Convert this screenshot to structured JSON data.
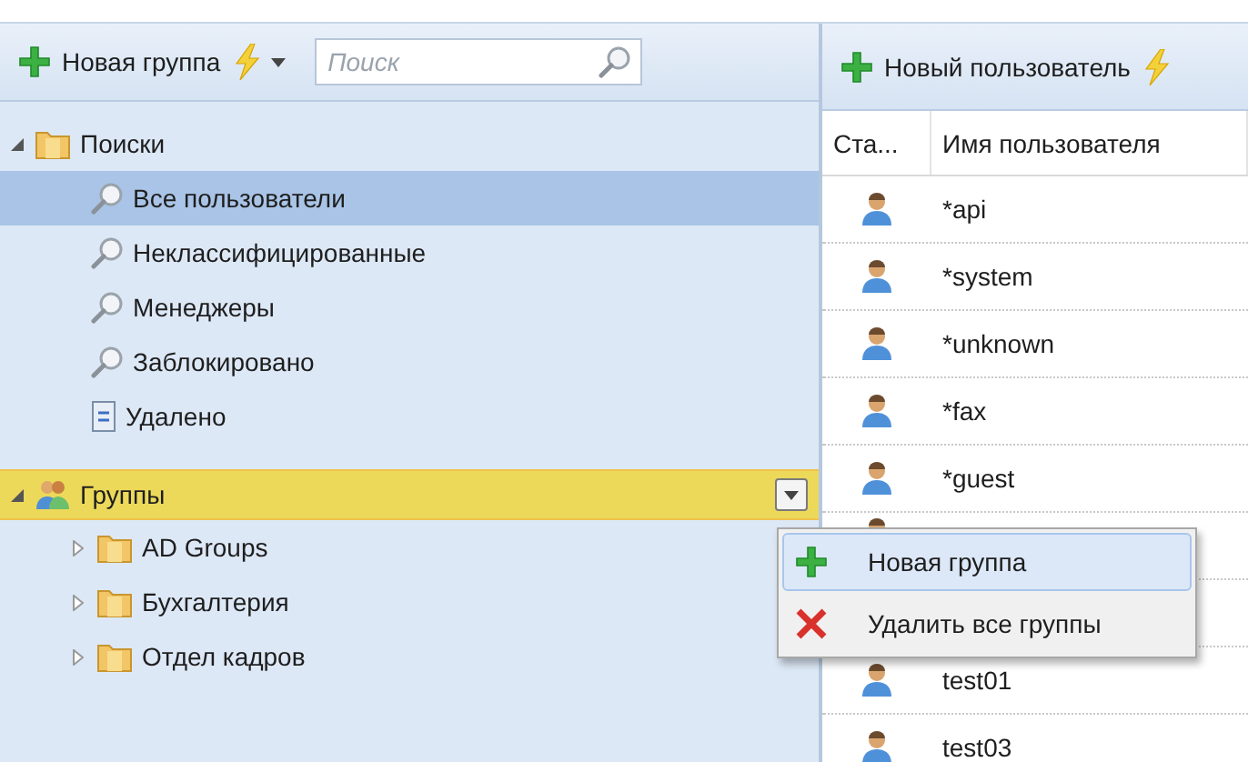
{
  "left_toolbar": {
    "new_group": "Новая группа",
    "search": {
      "placeholder": "Поиск"
    }
  },
  "tree": [
    {
      "label": "Поиски",
      "kind": "searches",
      "expanded": true,
      "highlighted": false,
      "children": [
        {
          "label": "Все пользователи",
          "kind": "search",
          "selected": true
        },
        {
          "label": "Неклассифицированные",
          "kind": "search",
          "selected": false
        },
        {
          "label": "Менеджеры",
          "kind": "search",
          "selected": false
        },
        {
          "label": "Заблокировано",
          "kind": "search",
          "selected": false
        },
        {
          "label": "Удалено",
          "kind": "trash",
          "selected": false
        }
      ]
    },
    {
      "label": "Группы",
      "kind": "groups",
      "expanded": true,
      "highlighted": true,
      "children": [
        {
          "label": "AD Groups",
          "kind": "folder",
          "selected": false,
          "expanded": false
        },
        {
          "label": "Бухгалтерия",
          "kind": "folder",
          "selected": false,
          "expanded": false
        },
        {
          "label": "Отдел кадров",
          "kind": "folder",
          "selected": false,
          "expanded": false
        }
      ]
    }
  ],
  "right_toolbar": {
    "new_user": "Новый пользователь"
  },
  "table": {
    "columns": [
      "Ста...",
      "Имя пользователя"
    ],
    "rows": [
      {
        "kind": "user",
        "name": "*api"
      },
      {
        "kind": "user",
        "name": "*system"
      },
      {
        "kind": "user",
        "name": "*unknown"
      },
      {
        "kind": "user",
        "name": "*fax"
      },
      {
        "kind": "user",
        "name": "*guest"
      },
      {
        "kind": "covered"
      },
      {
        "kind": "hidden"
      },
      {
        "kind": "user",
        "name": "test01"
      },
      {
        "kind": "user",
        "name": "test03"
      }
    ]
  },
  "context_menu": [
    {
      "label": "Новая группа",
      "kind": "add",
      "highlighted": true
    },
    {
      "label": "Удалить все группы",
      "kind": "delete",
      "highlighted": false
    }
  ]
}
